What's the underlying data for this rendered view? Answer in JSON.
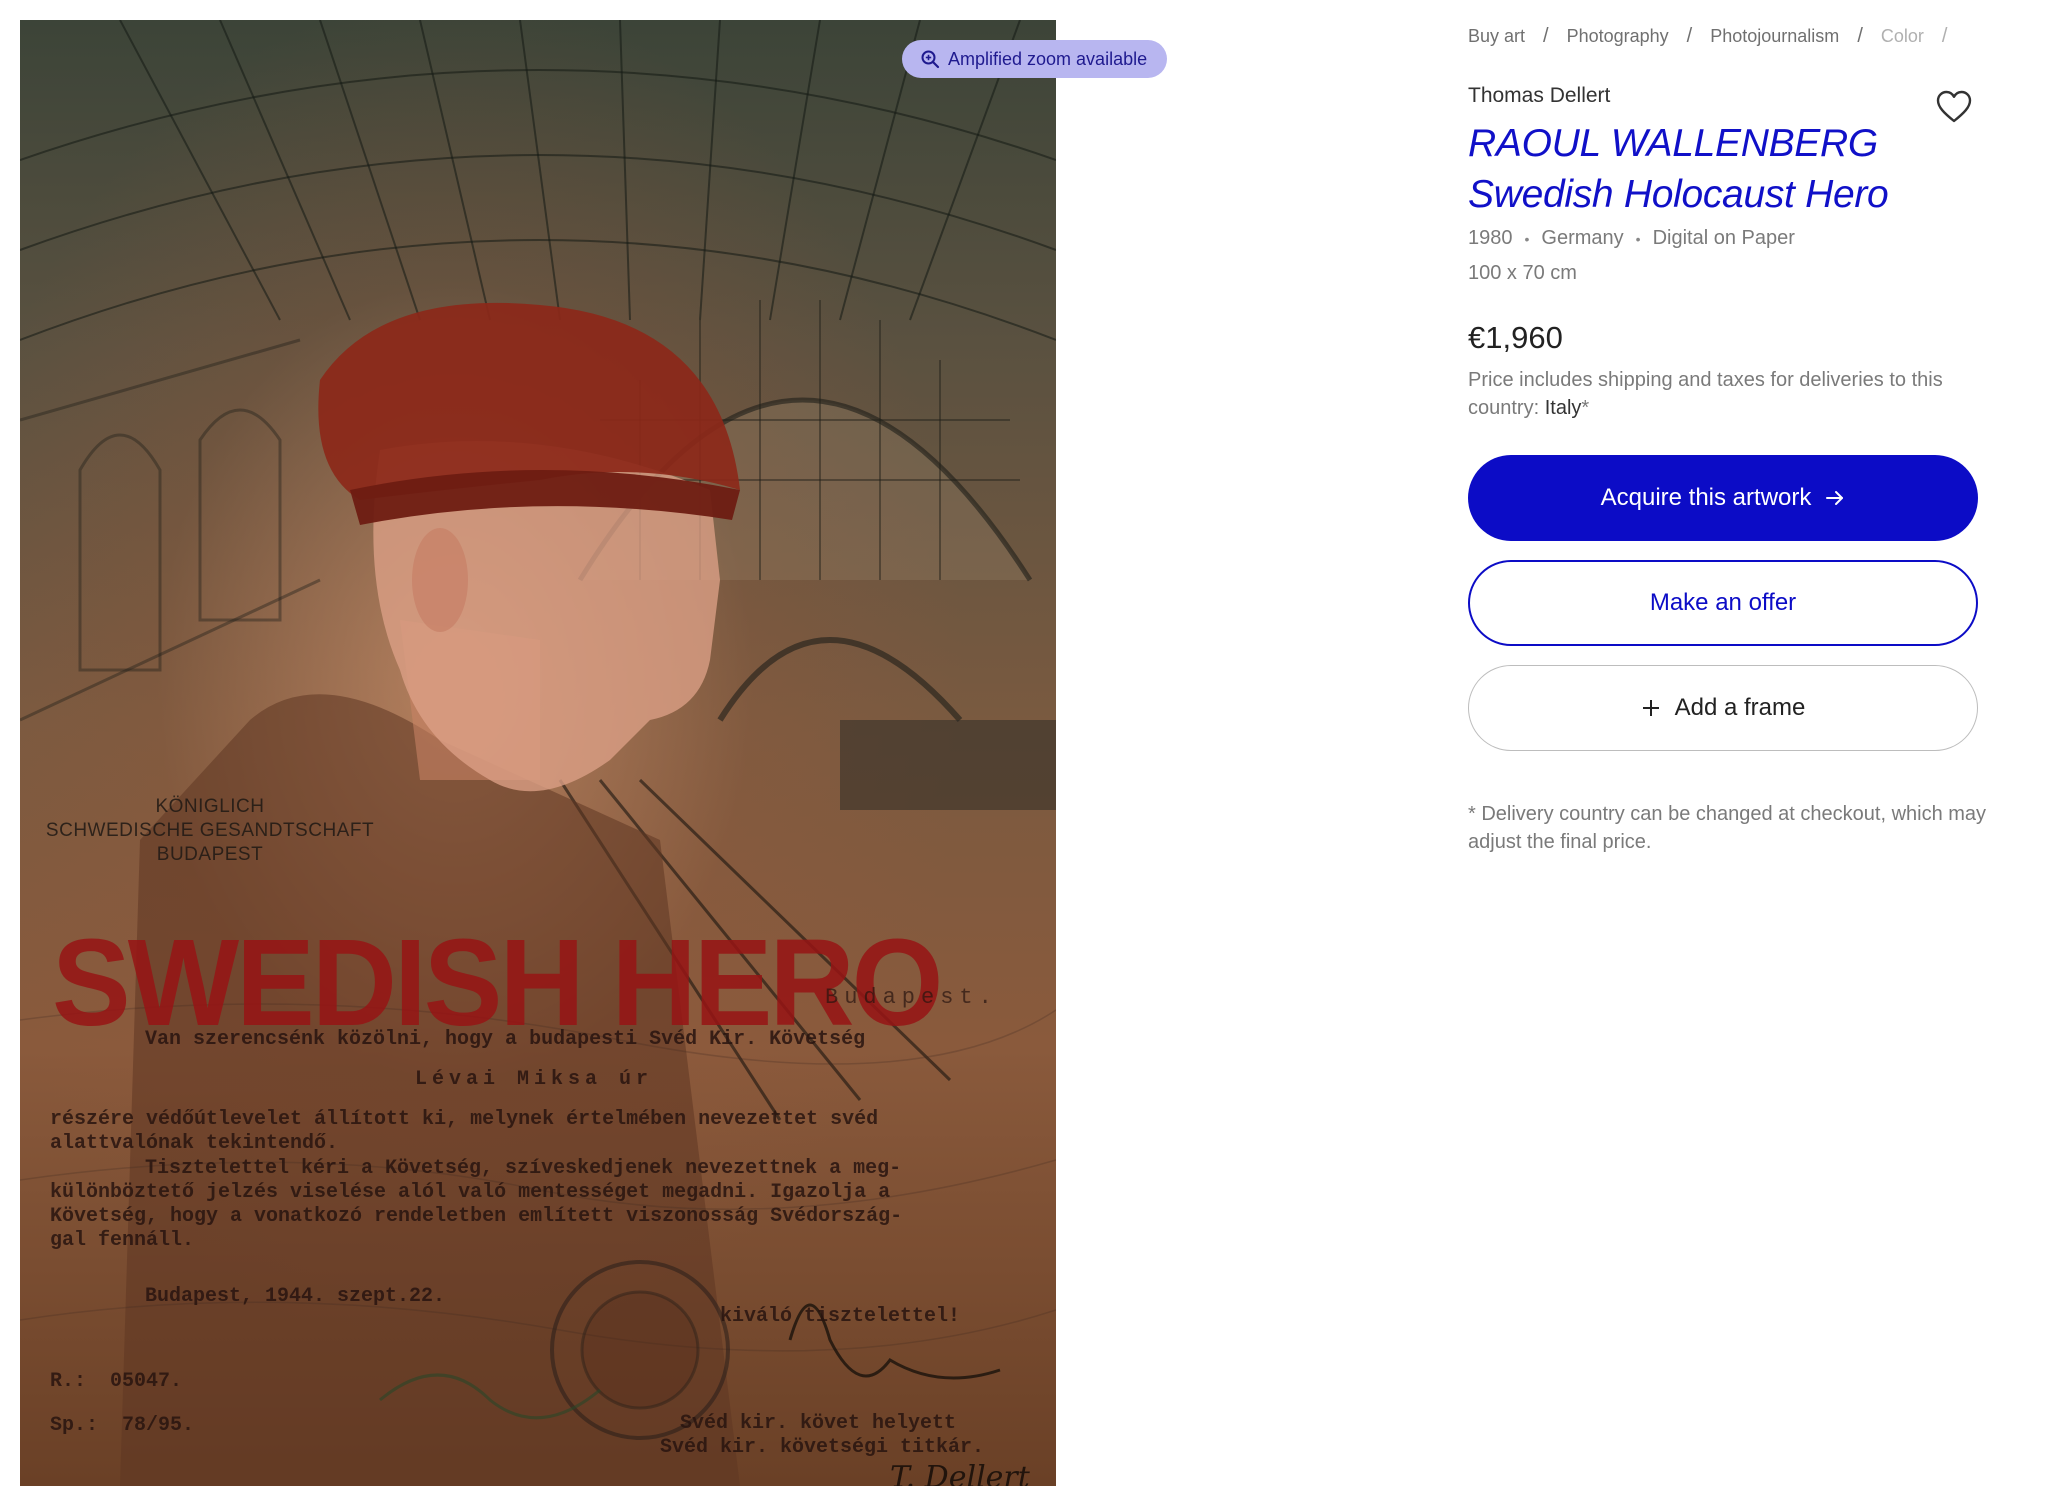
{
  "artwork": {
    "zoom_badge": "Amplified zoom available",
    "legation_lines": [
      "KÖNIGLICH",
      "SCHWEDISCHE GESANDTSCHAFT",
      "BUDAPEST"
    ],
    "headline": "SWEDISH HERO",
    "doc_budapest": "Budapest.",
    "doc_line1": "Van szerencsénk közölni, hogy a budapesti Svéd Kir. Követség",
    "doc_line2": "Lévai Miksa úr",
    "doc_line3": "részére védőútlevelet állított ki, melynek értelmében nevezettet svéd",
    "doc_line4": "alattvalónak tekintendő.",
    "doc_line5": "Tisztelettel kéri a Követség, szíveskedjenek nevezettnek a meg-",
    "doc_line6": "különböztető jelzés viselése alól való mentességet megadni. Igazolja a",
    "doc_line7": "Követség, hogy a vonatkozó rendeletben említett viszonosság Svédországgal fennáll.",
    "doc_line7a": "Követség, hogy a vonatkozó rendeletben említett viszonosság Svédország-",
    "doc_line7b": "gal fennáll.",
    "doc_date": "Budapest, 1944. szept.22.",
    "doc_regards": "kiváló tisztelettel!",
    "doc_r": "R.:  05047.",
    "doc_sp": "Sp.:  78/95.",
    "doc_sign1": "Svéd kir. követ helyett",
    "doc_sign2": "Svéd kir. követségi titkár.",
    "signature": "T. Dellert"
  },
  "breadcrumb": [
    "Buy art",
    "Photography",
    "Photojournalism",
    "Color"
  ],
  "artist": "Thomas Dellert",
  "title_line1": "RAOUL WALLENBERG",
  "title_line2": "Swedish Holocaust Hero",
  "meta": {
    "year": "1980",
    "country": "Germany",
    "medium": "Digital on Paper"
  },
  "dimensions": "100 x 70 cm",
  "price": "€1,960",
  "price_note_prefix": "Price includes shipping and taxes for deliveries to this country:",
  "price_note_country": "Italy",
  "price_note_asterisk": "*",
  "buttons": {
    "acquire": "Acquire this artwork",
    "offer": "Make an offer",
    "frame": "Add a frame"
  },
  "delivery_note": "* Delivery country can be changed at checkout, which may adjust the final price.",
  "colors": {
    "accent": "#0c0cc6",
    "badge_bg": "#b8b6f0",
    "title": "#1010c8"
  }
}
